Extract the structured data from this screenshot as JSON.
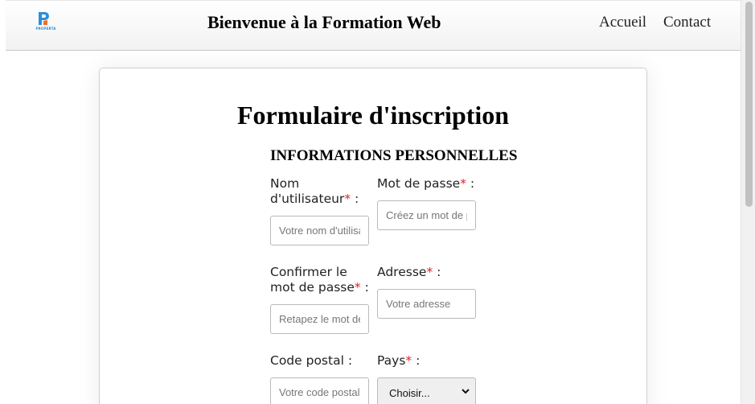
{
  "header": {
    "logo_text": "PROPERTA",
    "title": "Bienvenue à la Formation Web",
    "nav": [
      {
        "label": "Accueil"
      },
      {
        "label": "Contact"
      }
    ]
  },
  "form": {
    "title": "Formulaire d'inscription",
    "section_title": "INFORMATIONS PERSONNELLES",
    "required_mark": "*",
    "fields": {
      "username": {
        "label_line1": "Nom",
        "label_line2": "d'utilisateur",
        "suffix": " :",
        "placeholder": "Votre nom d'utilisateur"
      },
      "password": {
        "label": "Mot de passe",
        "suffix": " :",
        "placeholder": "Créez un mot de passe"
      },
      "confirm": {
        "label_line1": "Confirmer le",
        "label_line2": "mot de passe",
        "suffix": " :",
        "placeholder": "Retapez le mot de passe"
      },
      "address": {
        "label": "Adresse",
        "suffix": " :",
        "placeholder": "Votre adresse"
      },
      "postal": {
        "label": "Code postal :",
        "placeholder": "Votre code postal"
      },
      "country": {
        "label": "Pays",
        "suffix": " :",
        "selected": "Choisir..."
      }
    }
  },
  "colors": {
    "required": "#e0202a",
    "logo_blue": "#2f8fd8",
    "logo_orange": "#f26a2e"
  }
}
